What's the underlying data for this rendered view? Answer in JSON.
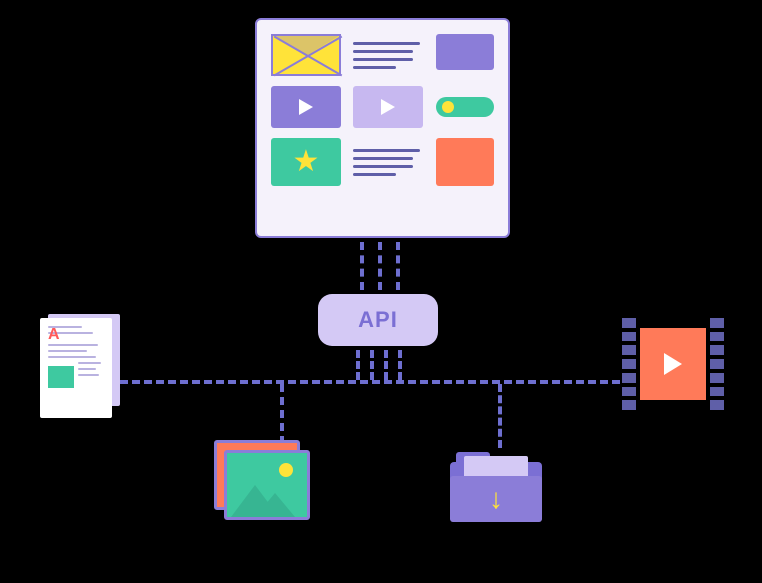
{
  "center": {
    "label": "API"
  },
  "nodes": {
    "webpage": {
      "name": "webpage"
    },
    "document": {
      "name": "document",
      "letter": "A"
    },
    "images": {
      "name": "images"
    },
    "folder": {
      "name": "download-folder",
      "icon": "download"
    },
    "video": {
      "name": "video-film"
    }
  },
  "colors": {
    "purple": "#8b7dd8",
    "lavender": "#d4c9f5",
    "orange": "#ff7a59",
    "teal": "#3ec9a0",
    "yellow": "#ffe339",
    "indigo": "#5f5fa8"
  }
}
